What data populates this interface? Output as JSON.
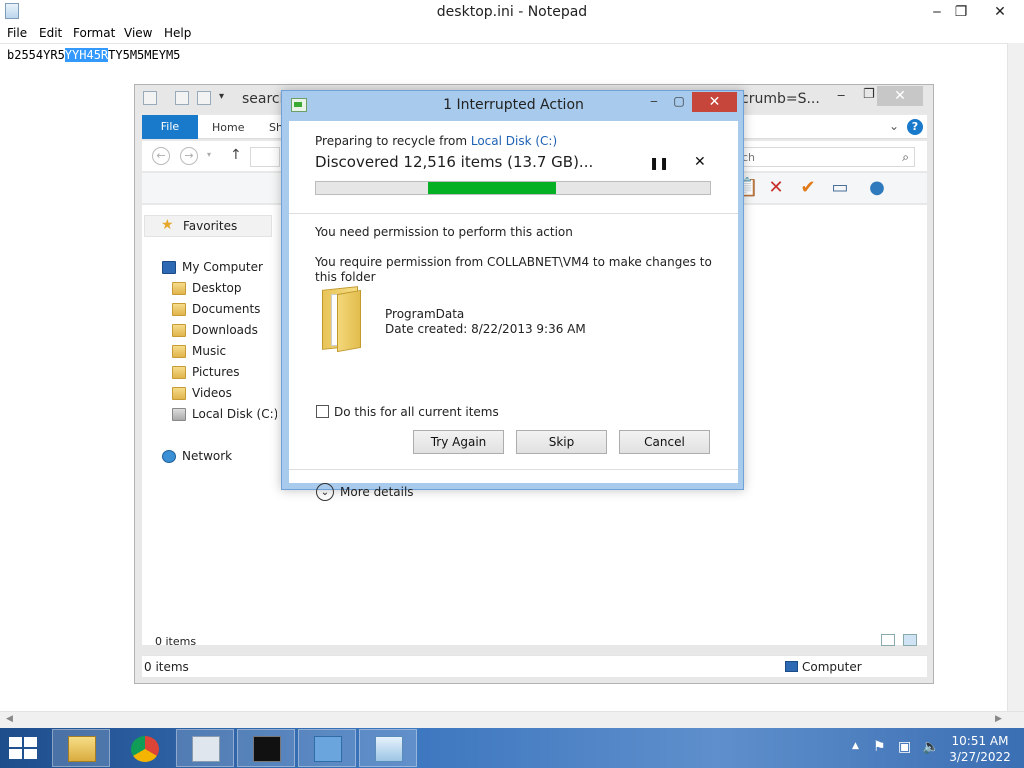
{
  "notepad": {
    "title": "desktop.ini - Notepad",
    "menu": [
      "File",
      "Edit",
      "Format",
      "View",
      "Help"
    ],
    "text_before": "b2554YR5",
    "text_selected": "YYH45R",
    "text_after": "TY5M5MEYM5"
  },
  "explorer": {
    "title_left": "search",
    "title_right": "crumb=S...",
    "ribbon_tabs": [
      "File",
      "Home",
      "Sh"
    ],
    "search_placeholder": "ch",
    "nav": {
      "favorites": "Favorites",
      "computer": "My Computer",
      "items": [
        "Desktop",
        "Documents",
        "Downloads",
        "Music",
        "Pictures",
        "Videos",
        "Local Disk (C:)"
      ],
      "network": "Network"
    },
    "main_count": "0 items",
    "status_left": "0 items",
    "status_right": "Computer"
  },
  "dialog": {
    "title": "1 Interrupted Action",
    "prep_text": "Preparing to recycle from ",
    "prep_link": "Local Disk (C:)",
    "discovered": "Discovered 12,516 items (13.7 GB)...",
    "progress": {
      "start_fraction": 0.285,
      "end_fraction": 0.61
    },
    "need_permission": "You need permission to perform this action",
    "require_text": "You require permission from COLLABNET\\VM4 to make changes to this folder",
    "file_name": "ProgramData",
    "file_date": "Date created: 8/22/2013 9:36 AM",
    "checkbox_label": "Do this for all current items",
    "buttons": {
      "try_again": "Try Again",
      "skip": "Skip",
      "cancel": "Cancel"
    },
    "more_details": "More details"
  },
  "taskbar": {
    "time": "10:51 AM",
    "date": "3/27/2022",
    "apps": [
      "file-explorer",
      "chrome",
      "performance-monitor",
      "command-prompt",
      "remote-desktop",
      "notepad"
    ]
  },
  "colors": {
    "accent": "#1979ca",
    "progress": "#06b025",
    "selection": "#3399ff",
    "dialog_frame": "#a8cbed",
    "close_red": "#c7463c"
  }
}
